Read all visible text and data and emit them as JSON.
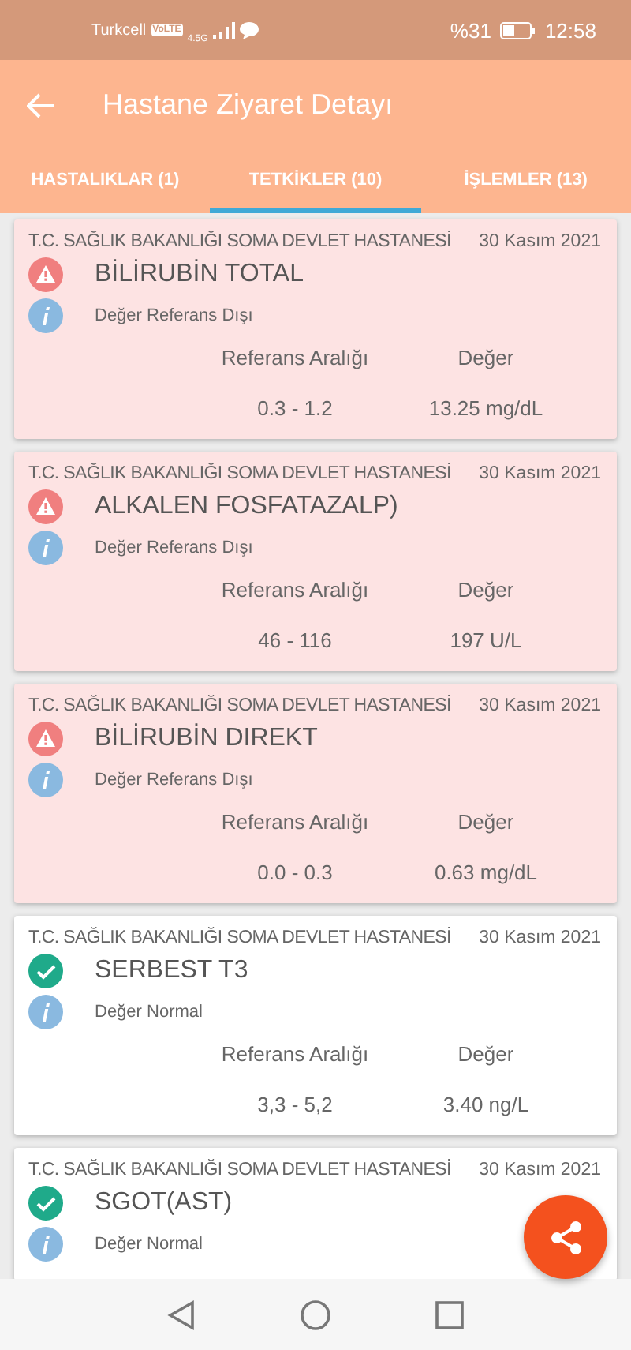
{
  "status_bar": {
    "carrier": "Turkcell",
    "volte": "VoLTE",
    "network": "4.5G",
    "battery": "%31",
    "time": "12:58"
  },
  "app_bar": {
    "title": "Hastane Ziyaret Detayı"
  },
  "tabs": [
    {
      "label": "HASTALIKLAR (1)",
      "selected": false
    },
    {
      "label": "TETKİKLER (10)",
      "selected": true
    },
    {
      "label": "İŞLEMLER (13)",
      "selected": false
    }
  ],
  "results": [
    {
      "hospital": "T.C. SAĞLIK BAKANLIĞI SOMA DEVLET HASTANESİ",
      "date": "30 Kasım 2021",
      "kind": "abnormal",
      "test": "BİLİRUBİN TOTAL",
      "note": "Değer Referans Dışı",
      "range_label": "Referans Aralığı",
      "value_label": "Değer",
      "range": "0.3 - 1.2",
      "value": "13.25 mg/dL"
    },
    {
      "hospital": "T.C. SAĞLIK BAKANLIĞI SOMA DEVLET HASTANESİ",
      "date": "30 Kasım 2021",
      "kind": "abnormal",
      "test": "ALKALEN FOSFATAZALP)",
      "note": "Değer Referans Dışı",
      "range_label": "Referans Aralığı",
      "value_label": "Değer",
      "range": "46 - 116",
      "value": "197 U/L"
    },
    {
      "hospital": "T.C. SAĞLIK BAKANLIĞI SOMA DEVLET HASTANESİ",
      "date": "30 Kasım 2021",
      "kind": "abnormal",
      "test": "BİLİRUBİN DIREKT",
      "note": "Değer Referans Dışı",
      "range_label": "Referans Aralığı",
      "value_label": "Değer",
      "range": "0.0 - 0.3",
      "value": "0.63 mg/dL"
    },
    {
      "hospital": "T.C. SAĞLIK BAKANLIĞI SOMA DEVLET HASTANESİ",
      "date": "30 Kasım 2021",
      "kind": "normal",
      "test": "SERBEST T3",
      "note": "Değer Normal",
      "range_label": "Referans Aralığı",
      "value_label": "Değer",
      "range": "3,3 - 5,2",
      "value": "3.40 ng/L"
    },
    {
      "hospital": "T.C. SAĞLIK BAKANLIĞI SOMA DEVLET HASTANESİ",
      "date": "30 Kasım 2021",
      "kind": "normal",
      "test": "SGOT(AST)",
      "note": "Değer Normal"
    }
  ]
}
